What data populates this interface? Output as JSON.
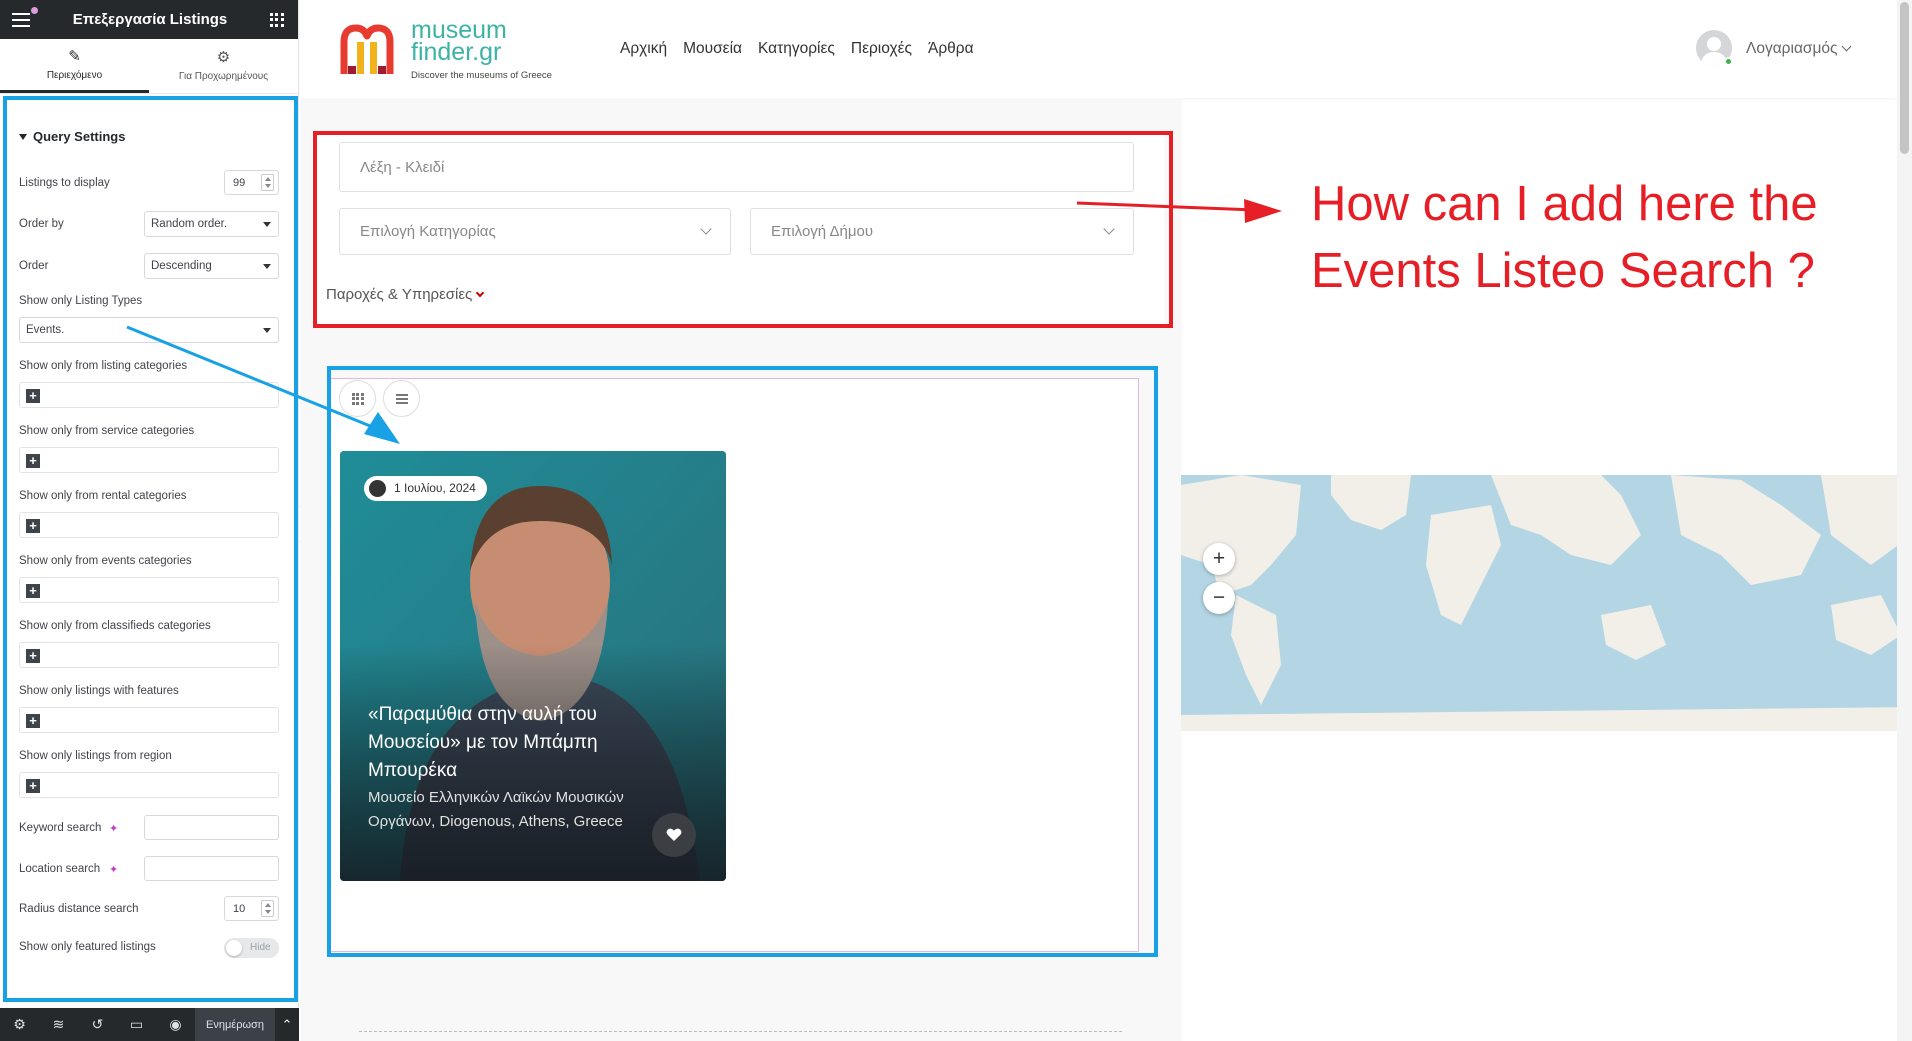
{
  "editor": {
    "title": "Επεξεργασία Listings",
    "tabs": [
      {
        "label": "Περιεχόμενο",
        "icon": "pencil-icon"
      },
      {
        "label": "Για Προχωρημένους",
        "icon": "gear-icon"
      }
    ],
    "section_title": "Query Settings",
    "fields": {
      "listings_to_display": {
        "label": "Listings to display",
        "value": "99"
      },
      "order_by": {
        "label": "Order by",
        "value": "Random order."
      },
      "order": {
        "label": "Order",
        "value": "Descending"
      },
      "listing_types": {
        "label": "Show only Listing Types",
        "value": "Events."
      },
      "listing_categories": {
        "label": "Show only from listing categories"
      },
      "service_categories": {
        "label": "Show only from service categories"
      },
      "rental_categories": {
        "label": "Show only from rental categories"
      },
      "events_categories": {
        "label": "Show only from events categories"
      },
      "classifieds_categories": {
        "label": "Show only from classifieds categories"
      },
      "features": {
        "label": "Show only listings with features"
      },
      "region": {
        "label": "Show only listings from region"
      },
      "keyword_search": {
        "label": "Keyword search",
        "value": ""
      },
      "location_search": {
        "label": "Location search",
        "value": ""
      },
      "radius_distance": {
        "label": "Radius distance search",
        "value": "10"
      },
      "featured_only": {
        "label": "Show only featured listings",
        "toggle_text": "Hide"
      }
    },
    "footer": {
      "update_label": "Ενημέρωση"
    }
  },
  "site": {
    "brand_line1": "museum",
    "brand_line2": "finder.gr",
    "tagline": "Discover the museums of Greece",
    "nav": [
      "Αρχική",
      "Μουσεία",
      "Κατηγορίες",
      "Περιοχές",
      "Άρθρα"
    ],
    "account_label": "Λογαριασμός"
  },
  "search": {
    "keyword_placeholder": "Λέξη - Κλειδί",
    "category_placeholder": "Επιλογή Κατηγορίας",
    "municipality_placeholder": "Επιλογή Δήμου",
    "more_label": "Παροχές & Υπηρεσίες"
  },
  "listing_card": {
    "date": "1 Ιουλίου, 2024",
    "title": "«Παραμύθια στην αυλή του Μουσείου» με τον Μπάμπη Μπουρέκα",
    "address": "Μουσείο Ελληνικών Λαϊκών Μουσικών Οργάνων, Diogenous, Athens, Greece"
  },
  "annotation": {
    "line1": "How can I add here the",
    "line2": "Events Listeo Search ?"
  },
  "map": {
    "zoom_in": "+",
    "zoom_out": "−"
  },
  "colors": {
    "annotation_red": "#e61e26",
    "annotation_blue": "#18a2e5",
    "brand_teal": "#3cb3a5",
    "editor_dark": "#26292c"
  }
}
